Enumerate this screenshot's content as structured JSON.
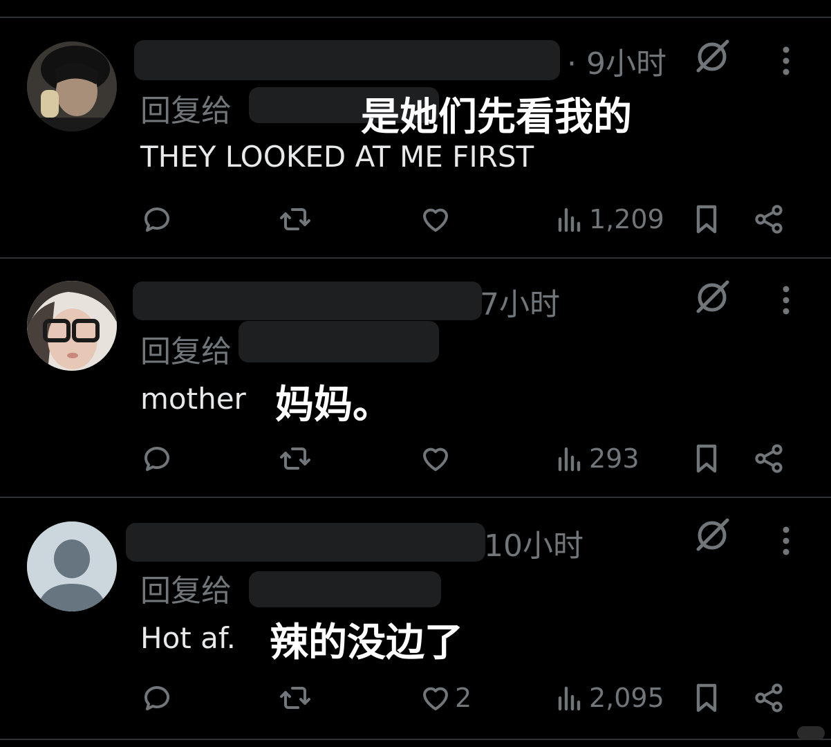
{
  "posts": [
    {
      "time": "· 9小时",
      "reply_label": "回复给",
      "text": "THEY LOOKED AT ME FIRST",
      "translation": "是她们先看我的",
      "likes": "",
      "views": "1,209"
    },
    {
      "time": "7小时",
      "reply_label": "回复给",
      "text": "mother",
      "translation": "妈妈。",
      "likes": "",
      "views": "293"
    },
    {
      "time": "10小时",
      "reply_label": "回复给",
      "text": "Hot af.",
      "translation": "辣的没边了",
      "likes": "2",
      "views": "2,095"
    }
  ],
  "colors": {
    "background": "#000000",
    "text": "#e7e9ea",
    "muted": "#71767b",
    "divider": "#2f3336"
  },
  "icons": [
    "reply-icon",
    "retweet-icon",
    "like-icon",
    "views-icon",
    "bookmark-icon",
    "share-icon",
    "grok-icon",
    "more-icon"
  ]
}
